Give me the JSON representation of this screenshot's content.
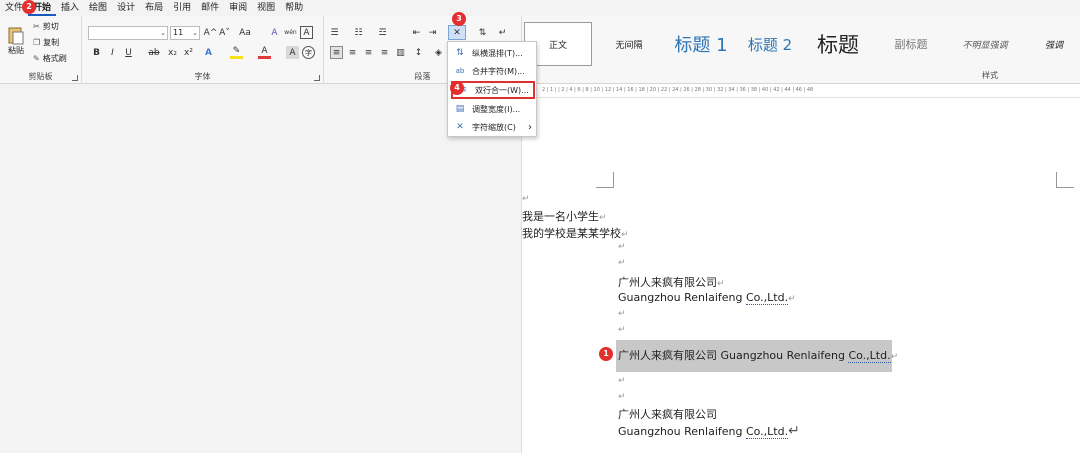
{
  "menu": {
    "items": [
      "文件",
      "开始",
      "插入",
      "绘图",
      "设计",
      "布局",
      "引用",
      "邮件",
      "审阅",
      "视图",
      "帮助"
    ]
  },
  "clipboard": {
    "paste": "粘贴",
    "cut": "剪切",
    "copy": "复制",
    "format_painter": "格式刷",
    "group": "剪贴板"
  },
  "font": {
    "name": "",
    "size": "11",
    "group": "字体",
    "grow": "A^",
    "shrink": "A˅",
    "case": "Aa",
    "clear": "A",
    "phonetic": "wén",
    "border": "A",
    "bold": "B",
    "italic": "I",
    "underline": "U",
    "strike": "ab",
    "sub": "x₂",
    "sup": "x²",
    "effects": "A",
    "highlight": "✎",
    "color": "A",
    "shade": "A",
    "enclose": "字"
  },
  "paragraph": {
    "group": "段落"
  },
  "styles": {
    "group": "样式",
    "items": [
      "正文",
      "无间隔",
      "标题 1",
      "标题 2",
      "标题",
      "副标题",
      "不明显强调",
      "强调"
    ]
  },
  "dropdown": {
    "items": [
      {
        "icon": "vertical-text-icon",
        "glyph": "⇅",
        "label": "纵横混排(T)..."
      },
      {
        "icon": "combine-chars-icon",
        "glyph": "ab",
        "label": "合并字符(M)..."
      },
      {
        "icon": "two-lines-in-one-icon",
        "glyph": "≡",
        "label": "双行合一(W)..."
      },
      {
        "icon": "fit-text-icon",
        "glyph": "▤",
        "label": "调整宽度(I)..."
      },
      {
        "icon": "char-scale-icon",
        "glyph": "✕",
        "label": "字符缩放(C)",
        "sub": "›"
      }
    ]
  },
  "badges": {
    "b1": "1",
    "b2": "2",
    "b3": "3",
    "b4": "4"
  },
  "ruler": {
    "text": "2 | 1 | | 2 | 4 | 6 | 8 | 10 | 12 | 14 | 16 | 18 | 20 | 22 | 24 | 26 | 28 | 30 | 32 | 34 | 36 | 38 | 40 | 42 | 44 | 46 | 48"
  },
  "doc": {
    "mark": "↵",
    "line1": "我是一名小学生",
    "line2": "我的学校是某某学校",
    "company_cn": "广州人来疯有限公司",
    "company_en_a": "Guangzhou Renlaifeng ",
    "company_en_b": "Co.,Ltd.",
    "combined_a": "广州人来疯有限公司 Guangzhou Renlaifeng ",
    "combined_b": "Co.,Ltd.",
    "company_cn2": "广州人来疯有限公司",
    "company_en2_a": "Guangzhou Renlaifeng ",
    "company_en2_b": "Co.,Ltd."
  },
  "colors": {
    "accent": "#185abd",
    "badge": "#e52e2e",
    "selection": "#c8c8c8"
  }
}
